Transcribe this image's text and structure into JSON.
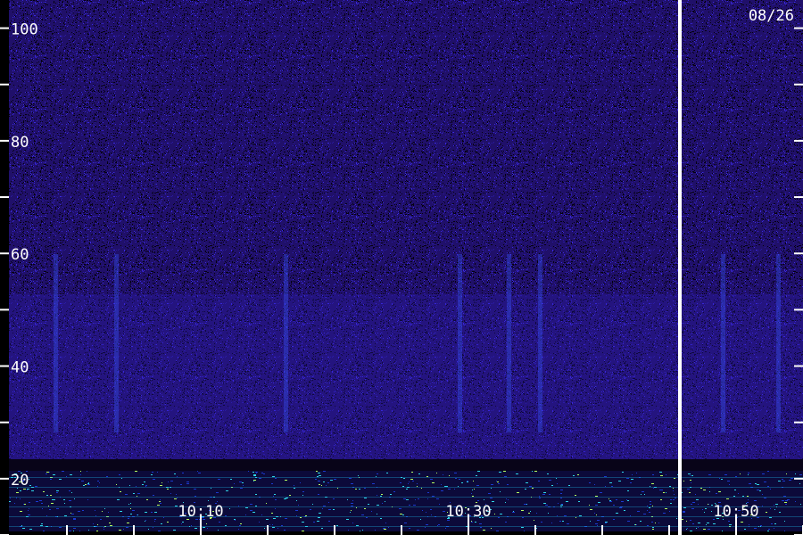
{
  "chart_data": {
    "type": "heatmap",
    "title": "",
    "xlabel": "",
    "ylabel": "",
    "date_label": "08/26",
    "y_axis": {
      "range": [
        10,
        105
      ],
      "major_ticks": [
        100,
        80,
        60,
        40,
        20
      ],
      "minor_ticks": [
        90,
        70,
        50,
        30,
        10
      ],
      "tick_labels": [
        "100",
        "80",
        "60",
        "40",
        "20"
      ]
    },
    "x_axis": {
      "tick_labels": [
        "10:10",
        "10:30",
        "10:50"
      ],
      "major_ticks": [
        "10:10",
        "10:30",
        "10:50"
      ],
      "minor_ticks": [
        "10:00",
        "10:05",
        "10:15",
        "10:20",
        "10:25",
        "10:35",
        "10:40",
        "10:45",
        "10:55",
        "11:00"
      ]
    },
    "marker_line_time": "10:46",
    "colors": {
      "background": "#000000",
      "low": "#20106a",
      "mid": "#3a2ae0",
      "high": "#2fd6e8",
      "peak": "#b8ff60",
      "axis": "#ffffff"
    }
  }
}
